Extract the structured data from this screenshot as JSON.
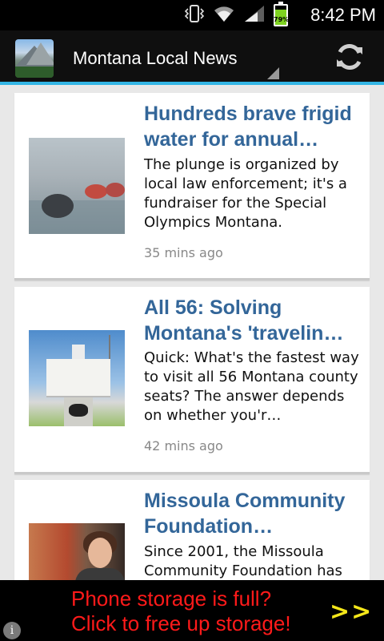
{
  "status_bar": {
    "time": "8:42 PM",
    "battery_level": 0.79,
    "battery_label": "79%",
    "icons": [
      "vibrate-icon",
      "wifi-icon",
      "signal-icon",
      "battery-icon"
    ]
  },
  "action_bar": {
    "title": "Montana Local News",
    "icons": [
      "app-icon",
      "refresh-icon"
    ],
    "accent_color": "#33b5e5"
  },
  "articles": [
    {
      "title": "Hundreds brave frigid water for annual…",
      "summary": "The plunge is organized by local law enforcement; it's a fundraiser for the Special Olympics Montana.",
      "time": "35 mins ago"
    },
    {
      "title": "All 56: Solving Montana's 'travelin…",
      "summary": "Quick: What's the fastest way to visit all 56 Montana county seats? The answer depends on whether you'r…",
      "time": "42 mins ago"
    },
    {
      "title": "Missoula Community Foundation…",
      "summary": "Since 2001, the Missoula Community Foundation has"
    }
  ],
  "ad": {
    "line1": "Phone storage is full?",
    "line2": "Click to free up storage!",
    "arrows": ">>",
    "info": "i",
    "text_color": "#ff1a1a",
    "arrow_color": "#f5e71a"
  },
  "colors": {
    "title_link": "#336699",
    "background": "#e8e8e8"
  }
}
